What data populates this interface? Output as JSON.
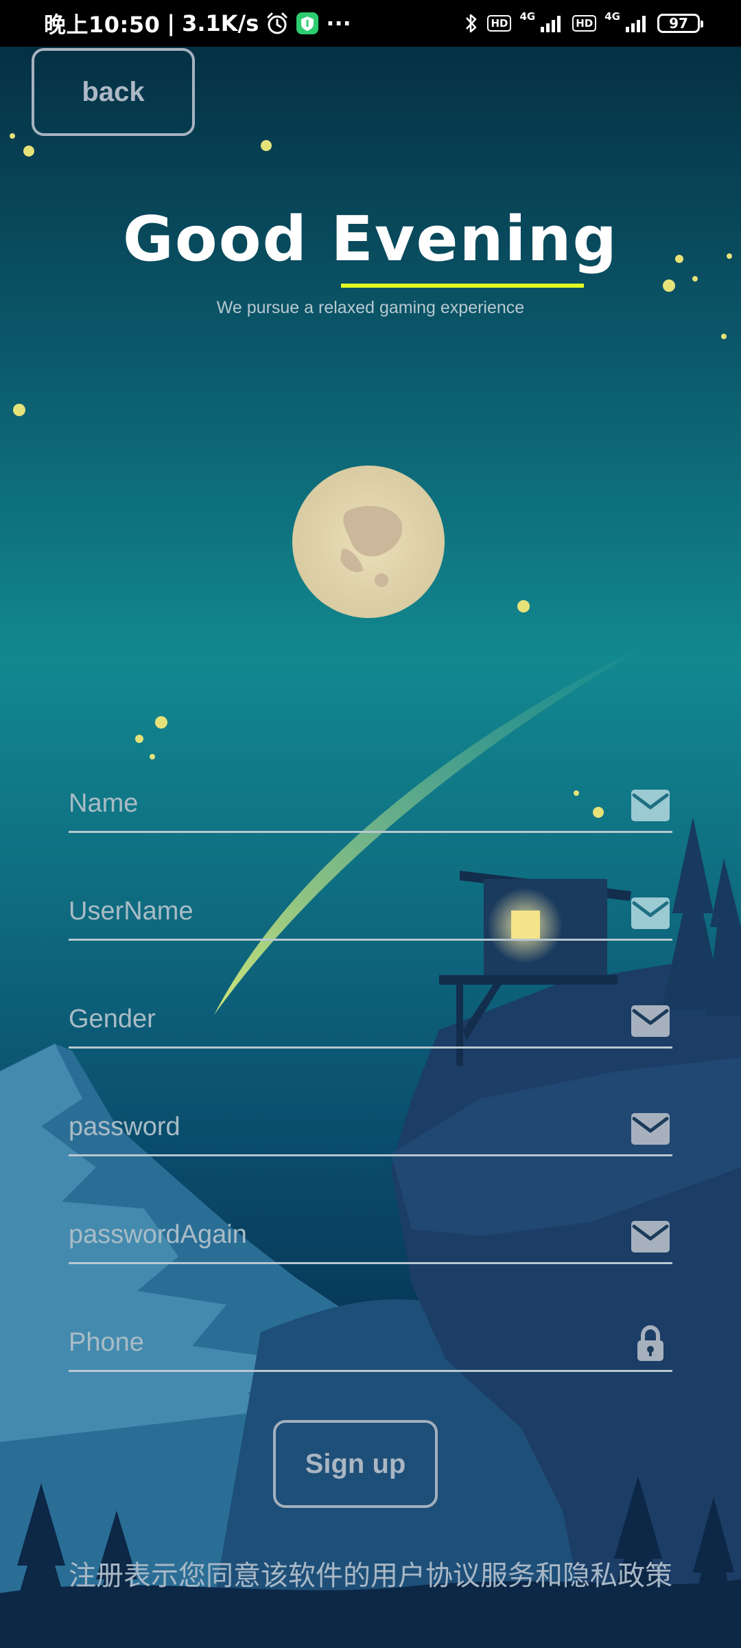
{
  "status_bar": {
    "time": "晚上10:50",
    "separator": "|",
    "net_speed": "3.1K/s",
    "more": "···",
    "hd_label": "HD",
    "net_type": "4G",
    "battery": "97"
  },
  "header": {
    "back_label": "back",
    "title": "Good Evening",
    "subtitle": "We pursue a relaxed gaming experience",
    "accent_color": "#e2ff24"
  },
  "form": {
    "fields": [
      {
        "label": "Name",
        "icon": "mail-icon"
      },
      {
        "label": "UserName",
        "icon": "mail-icon"
      },
      {
        "label": "Gender",
        "icon": "mail-icon"
      },
      {
        "label": "password",
        "icon": "mail-icon"
      },
      {
        "label": "passwordAgain",
        "icon": "mail-icon"
      },
      {
        "label": "Phone",
        "icon": "lock-icon"
      }
    ],
    "submit_label": "Sign up"
  },
  "footer": {
    "agreement": "注册表示您同意该软件的用户协议服务和隐私政策"
  }
}
